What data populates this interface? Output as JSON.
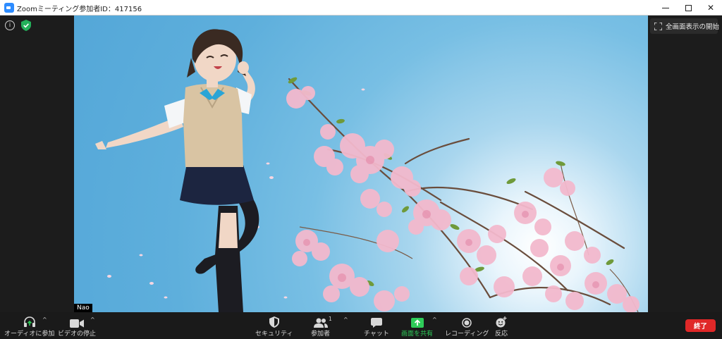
{
  "window": {
    "title": "Zoomミーティング参加者ID：417156"
  },
  "stage": {
    "fullscreen_label": "全画面表示の開始",
    "participant_name": "Nao"
  },
  "toolbar": {
    "audio_label": "オーディオに参加",
    "video_label": "ビデオの停止",
    "security_label": "セキュリティ",
    "participants_label": "参加者",
    "participants_count": "1",
    "chat_label": "チャット",
    "share_label": "画面を共有",
    "record_label": "レコーディング",
    "reactions_label": "反応",
    "end_label": "終了"
  },
  "colors": {
    "accent_green": "#2ecc59",
    "end_red": "#e02828",
    "sky_blue": "#5eafdc",
    "blossom_pink": "#f2b8cc"
  }
}
